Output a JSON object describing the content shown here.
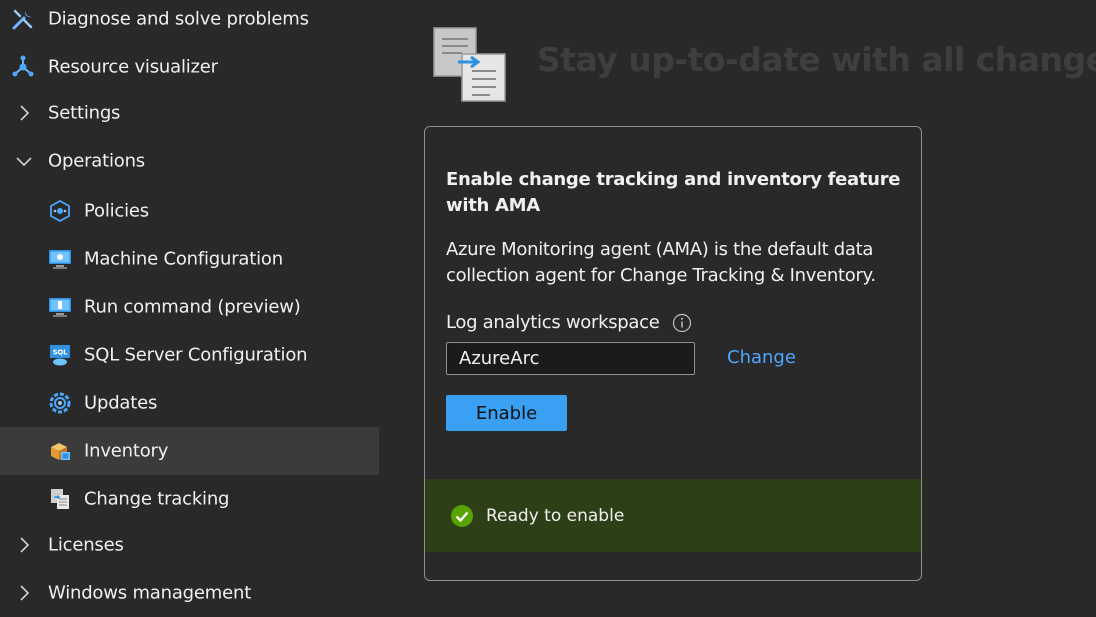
{
  "sidebar": {
    "items": [
      {
        "label": "Diagnose and solve problems",
        "icon": "wrench-icon"
      },
      {
        "label": "Resource visualizer",
        "icon": "resource-visualizer-icon"
      },
      {
        "label": "Settings",
        "icon": "chevron-right-icon",
        "expanded": false
      },
      {
        "label": "Operations",
        "icon": "chevron-down-icon",
        "expanded": true
      },
      {
        "label": "Policies",
        "icon": "policies-icon"
      },
      {
        "label": "Machine Configuration",
        "icon": "machine-configuration-icon"
      },
      {
        "label": "Run command (preview)",
        "icon": "run-command-icon"
      },
      {
        "label": "SQL Server Configuration",
        "icon": "sql-server-icon"
      },
      {
        "label": "Updates",
        "icon": "updates-icon"
      },
      {
        "label": "Inventory",
        "icon": "inventory-icon",
        "selected": true
      },
      {
        "label": "Change tracking",
        "icon": "change-tracking-icon"
      },
      {
        "label": "Licenses",
        "icon": "chevron-right-icon",
        "expanded": false
      },
      {
        "label": "Windows management",
        "icon": "chevron-right-icon",
        "expanded": false
      }
    ]
  },
  "main": {
    "hero_title": "Stay up-to-date with all changes",
    "hero_icon": "change-tracking-document-icon",
    "card": {
      "heading": "Enable change tracking and inventory feature with AMA",
      "description": "Azure Monitoring agent (AMA) is the default data collection agent for Change Tracking & Inventory.",
      "workspace_label": "Log analytics workspace",
      "workspace_value": "AzureArc",
      "change_link": "Change",
      "enable_button": "Enable",
      "status_text": "Ready to enable",
      "status_icon": "checkmark-circle-icon"
    }
  },
  "colors": {
    "background": "#292929",
    "selected_item": "#3b3b3b",
    "accent_button": "#3aa0f3",
    "link": "#4da6ff",
    "success_bar": "#2d3f16",
    "success_icon": "#57a300"
  }
}
